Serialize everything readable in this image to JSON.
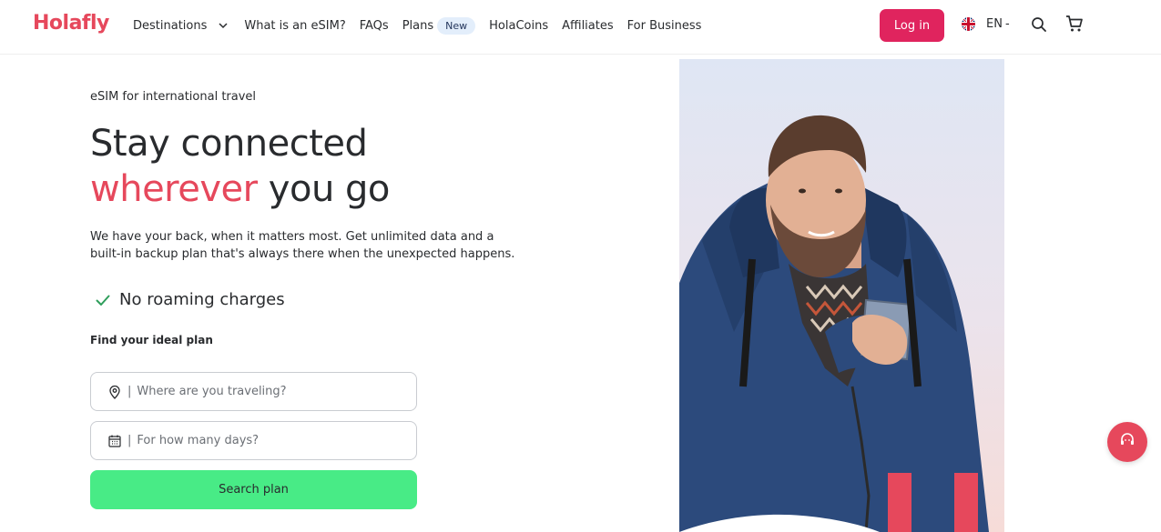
{
  "brand": {
    "logo_text": "Holafly",
    "accent_color": "#e6485c"
  },
  "nav": {
    "items": [
      {
        "label": "Destinations"
      },
      {
        "label": "What is an eSIM?"
      },
      {
        "label": "FAQs"
      },
      {
        "label": "Plans",
        "badge": "New"
      },
      {
        "label": "HolaCoins"
      },
      {
        "label": "Affiliates"
      },
      {
        "label": "For Business"
      }
    ],
    "login_label": "Log in",
    "language": "EN",
    "language_caret": "-"
  },
  "hero": {
    "eyebrow": "eSIM for international travel",
    "headline_line1": "Stay connected",
    "headline_accent": "wherever",
    "headline_rest": " you go",
    "description": "We have your back, when it matters most. Get unlimited data and a built-in backup plan that's always there when the unexpected happens.",
    "feature": "No roaming charges"
  },
  "search": {
    "label": "Find your ideal plan",
    "destination_placeholder": "Where are you traveling?",
    "days_placeholder": "For how many days?",
    "separator": "|",
    "button_label": "Search plan",
    "button_color": "#48eb86"
  },
  "icons": {
    "destinations_chevron": "chevron-down-icon",
    "language_flag": "uk-flag-icon",
    "search": "search-icon",
    "cart": "cart-icon",
    "feature_check": "check-icon",
    "destination_field": "location-pin-icon",
    "days_field": "calendar-icon",
    "support": "support-headset-icon"
  }
}
